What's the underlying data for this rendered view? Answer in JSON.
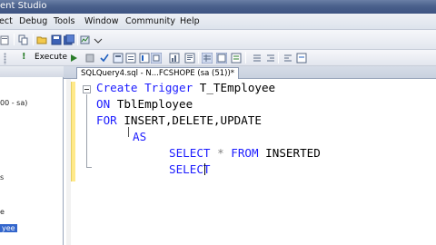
{
  "window": {
    "title_fragment": "ent Studio"
  },
  "menu": {
    "items": [
      "ect",
      "Debug",
      "Tools",
      "Window",
      "Community",
      "Help"
    ]
  },
  "toolbar": {
    "execute_label": "Execute"
  },
  "explorer": {
    "fragments": [
      "00 - sa)",
      "s",
      "e",
      "yee"
    ]
  },
  "tab": {
    "label": "SQLQuery4.sql - N...FCSHOPE (sa (51))*"
  },
  "editor": {
    "line1": {
      "kw": "Create Trigger",
      "rest": " T_TEmployee"
    },
    "line2": {
      "kw": "ON",
      "rest": " TblEmployee"
    },
    "line3": {
      "kw": "FOR",
      "rest": " INSERT,DELETE,UPDATE"
    },
    "line4": {
      "kw": "AS"
    },
    "line5": {
      "kw1": "SELECT",
      "op": " * ",
      "kw2": "FROM",
      "rest": " INSERTED"
    },
    "line6": {
      "kw_a": "SELE",
      "kw_b": "CT"
    }
  }
}
